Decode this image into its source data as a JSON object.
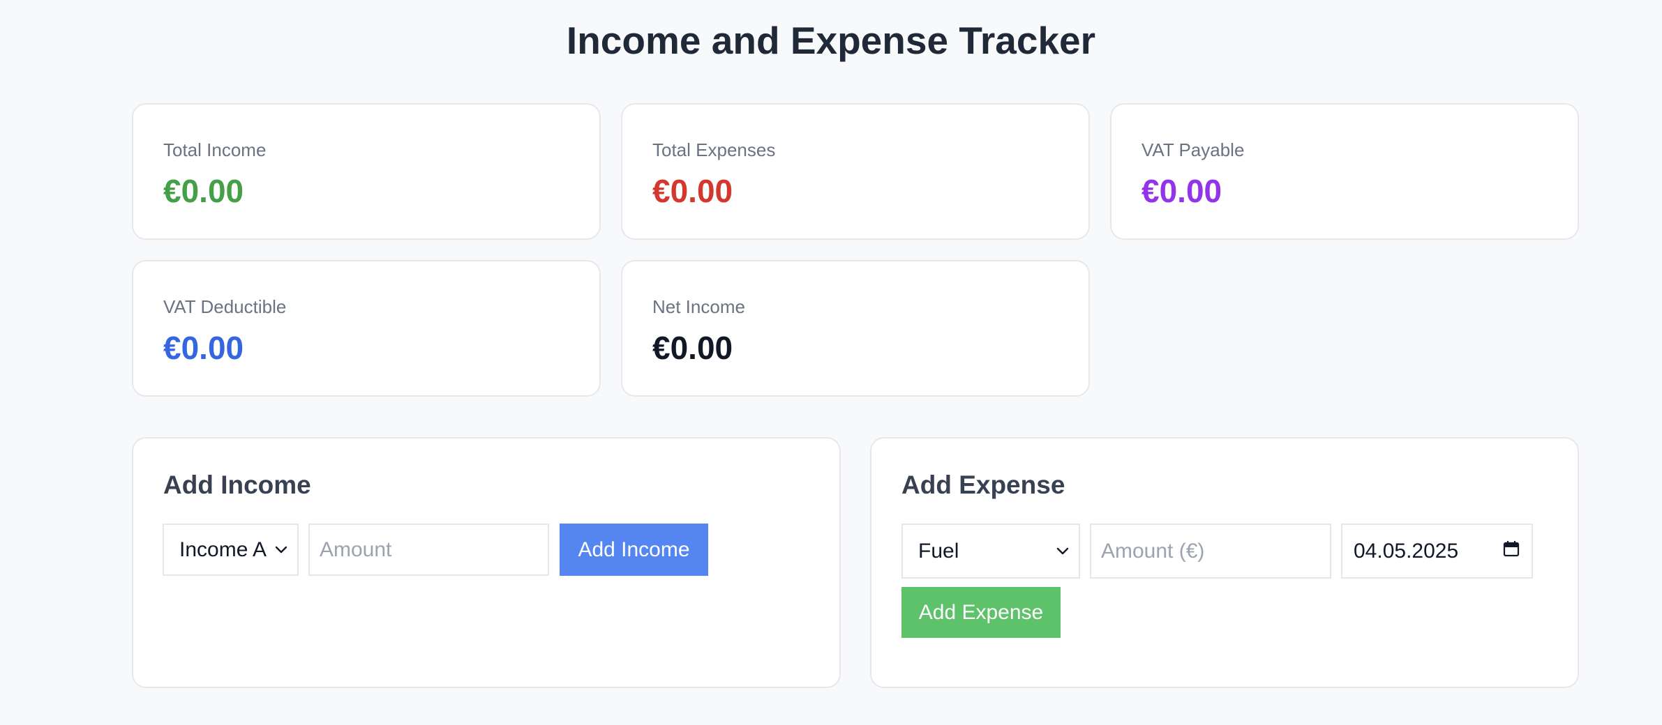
{
  "title": "Income and Expense Tracker",
  "stats": [
    {
      "label": "Total Income",
      "value": "€0.00",
      "color": "#43a047"
    },
    {
      "label": "Total Expenses",
      "value": "€0.00",
      "color": "#d3382f"
    },
    {
      "label": "VAT Payable",
      "value": "€0.00",
      "color": "#9333ea"
    },
    {
      "label": "VAT Deductible",
      "value": "€0.00",
      "color": "#3566e0"
    },
    {
      "label": "Net Income",
      "value": "€0.00",
      "color": "#111827"
    }
  ],
  "income_form": {
    "title": "Add Income",
    "source_value": "Income A",
    "amount_placeholder": "Amount",
    "submit_label": "Add Income",
    "submit_color": "#5585f0"
  },
  "expense_form": {
    "title": "Add Expense",
    "category_value": "Fuel",
    "amount_placeholder": "Amount (€)",
    "date_value": "04.05.2025",
    "submit_label": "Add Expense",
    "submit_color": "#5dc26a"
  }
}
